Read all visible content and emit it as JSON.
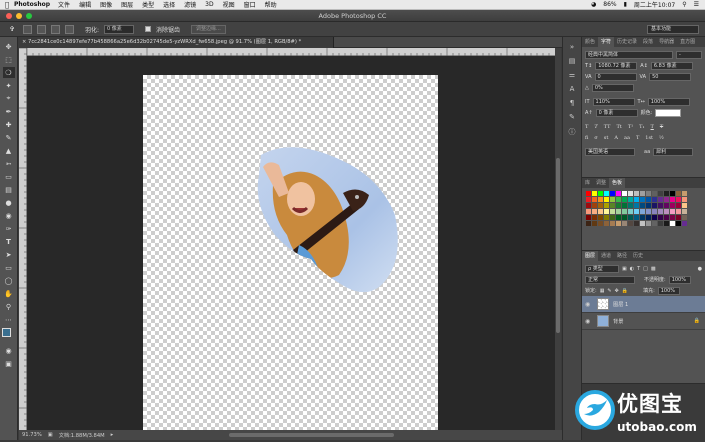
{
  "menubar": {
    "app": "Photoshop",
    "items": [
      "文件",
      "编辑",
      "图像",
      "图层",
      "类型",
      "选择",
      "滤镜",
      "3D",
      "视图",
      "窗口",
      "帮助"
    ],
    "battery": "86%",
    "clock": "周二上午10:07"
  },
  "titlebar": {
    "title": "Adobe Photoshop CC"
  },
  "options": {
    "feather_label": "羽化:",
    "feather_value": "0 像素",
    "antialias_label": "消除锯齿",
    "refine_label": "调整边缘...",
    "workspace": "基本功能"
  },
  "document": {
    "tab": "7cc2841ce0c14897efe77b458866a25e6d32b02745de5-yzWRXd_fw658.jpeg @ 91.7% (图层 1, RGB/8#) *"
  },
  "status": {
    "zoom": "91.73%",
    "doc_size": "文档:1.88M/3.84M"
  },
  "character_panel": {
    "tabs": [
      "颜色",
      "字符",
      "历史记录",
      "段落",
      "导航器",
      "直方图"
    ],
    "font_family": "经典中黑简体",
    "font_style": "-",
    "font_size": "1080.72 像素",
    "leading": "6.83 像素",
    "kerning": "0",
    "tracking": "50",
    "scale_v_pct": "0%",
    "scale_v": "110%",
    "scale_h": "100%",
    "baseline": "0 像素",
    "color_label": "颜色:",
    "language": "美国英语",
    "antialias": "犀利",
    "aa_prefix": "aa"
  },
  "swatches_panel": {
    "tabs": [
      "库",
      "调整",
      "色板"
    ],
    "colors": [
      "#ff0000",
      "#ffff00",
      "#00ff00",
      "#00ffff",
      "#0000ff",
      "#ff00ff",
      "#ffffff",
      "#e0e0e0",
      "#c0c0c0",
      "#a0a0a0",
      "#808080",
      "#606060",
      "#404040",
      "#202020",
      "#000000",
      "#8c6239",
      "#c69c6d",
      "#ed1c24",
      "#f26522",
      "#f7941d",
      "#fff200",
      "#8dc63f",
      "#39b54a",
      "#00a651",
      "#00a99d",
      "#00aeef",
      "#0072bc",
      "#0054a6",
      "#2e3192",
      "#662d91",
      "#92278f",
      "#ec008c",
      "#ed145b",
      "#f69679",
      "#9e0b0f",
      "#a0410d",
      "#a3620a",
      "#aba000",
      "#598527",
      "#197b30",
      "#007236",
      "#00746b",
      "#0076a3",
      "#004a80",
      "#003471",
      "#1b1464",
      "#440e62",
      "#630460",
      "#9e005d",
      "#9e0039",
      "#fdc689",
      "#f7977a",
      "#f9ad81",
      "#fdc68a",
      "#fff79a",
      "#c4df9b",
      "#a3d39c",
      "#82ca9d",
      "#7bcdc8",
      "#6ecff6",
      "#7ea7d8",
      "#8493ca",
      "#8882be",
      "#a187be",
      "#bc8dbf",
      "#f49ac2",
      "#f6989d",
      "#c7b299",
      "#790000",
      "#7b2e00",
      "#7d4900",
      "#827b00",
      "#406618",
      "#005e20",
      "#005826",
      "#005952",
      "#005b7f",
      "#003663",
      "#002157",
      "#0d004c",
      "#32004b",
      "#4b0049",
      "#7b0046",
      "#7a0026",
      "#736357",
      "#3c2415",
      "#603913",
      "#754c24",
      "#8c6239",
      "#a67c52",
      "#c69c6d",
      "#998675",
      "#534741",
      "#362f2d",
      "#c2c2c2",
      "#959595",
      "#636363",
      "#3b3b3b",
      "#1a1a1a",
      "#ffffff",
      "#000000",
      "#662d91"
    ]
  },
  "layers_panel": {
    "tabs": [
      "图层",
      "通道",
      "路径",
      "历史"
    ],
    "filter": "ρ 类型",
    "blend_mode": "正常",
    "opacity_label": "不透明度:",
    "opacity": "100%",
    "lock_label": "锁定:",
    "fill_label": "填充:",
    "fill": "100%",
    "layers": [
      {
        "name": "图层 1",
        "selected": true
      },
      {
        "name": "背景",
        "selected": false
      }
    ]
  },
  "watermark": {
    "cn": "优图宝",
    "en": "utobao.com"
  },
  "colors": {
    "accent": "#2aa8e0",
    "selection": "#6c7c95"
  }
}
